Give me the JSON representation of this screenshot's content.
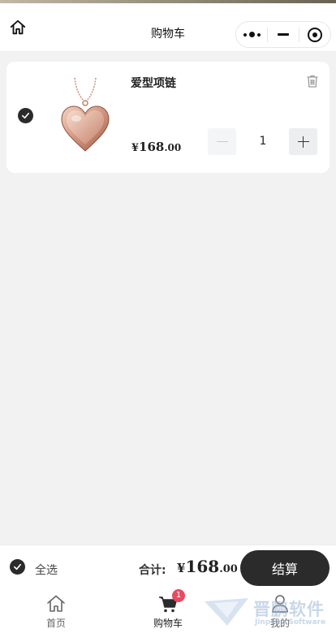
{
  "nav": {
    "title": "购物车",
    "home_icon": "home-icon",
    "capsule": {
      "more_icon": "more-dots-icon",
      "minimize_icon": "minimize-icon",
      "close_icon": "target-icon"
    }
  },
  "cart": {
    "items": [
      {
        "name": "爱型项链",
        "checked": true,
        "image_icon": "heart-necklace-image",
        "price_symbol": "¥",
        "price_integer": "168",
        "price_decimal": ".00",
        "quantity": "1",
        "delete_icon": "trash-icon"
      }
    ]
  },
  "checkout": {
    "select_all_label": "全选",
    "select_all_checked": true,
    "total_label": "合计:",
    "total_symbol": "¥",
    "total_integer": "168",
    "total_decimal": ".00",
    "checkout_button": "结算"
  },
  "tabbar": {
    "items": [
      {
        "label": "首页",
        "icon": "home-icon",
        "active": false
      },
      {
        "label": "购物车",
        "icon": "cart-icon",
        "active": true,
        "badge": "1"
      },
      {
        "label": "我的",
        "icon": "user-icon",
        "active": false
      }
    ]
  },
  "watermark": {
    "title": "晋鹏软件",
    "subtitle": "Jinpeng Software"
  },
  "colors": {
    "accent_dark": "#2b2b2b",
    "badge": "#e94a5f",
    "background": "#f2f2f2"
  }
}
